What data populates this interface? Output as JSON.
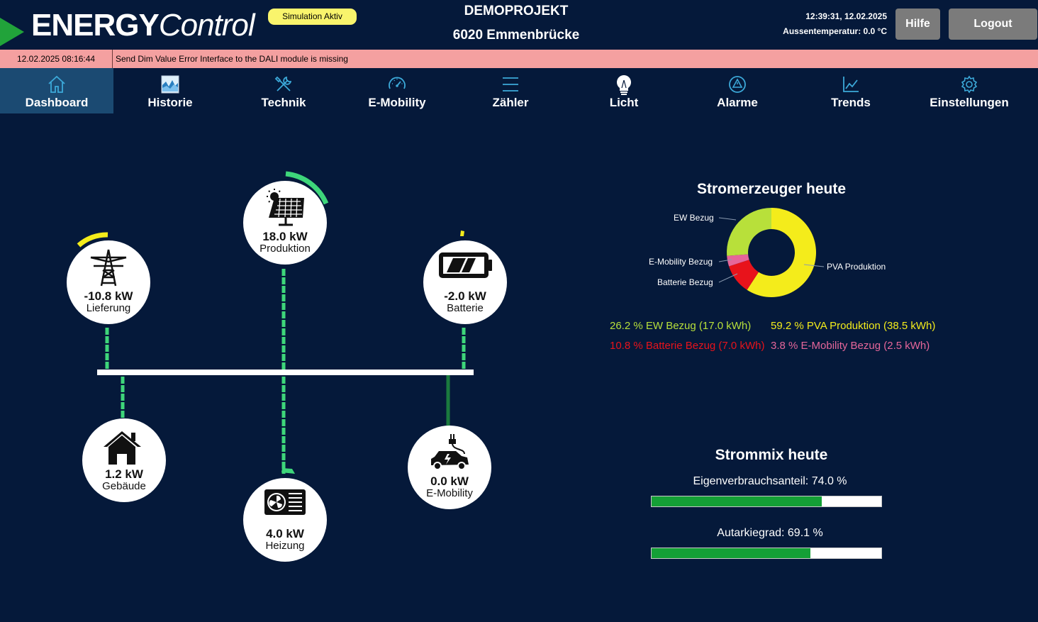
{
  "header": {
    "logo_part1": "ENERGY",
    "logo_part2": "Control",
    "simulation_badge": "Simulation Aktiv",
    "project_name": "DEMOPROJEKT",
    "project_location": "6020 Emmenbrücke",
    "datetime": "12:39:31, 12.02.2025",
    "outside_temp": "Aussentemperatur: 0.0 °C",
    "help_label": "Hilfe",
    "logout_label": "Logout"
  },
  "alarm": {
    "timestamp": "12.02.2025 08:16:44",
    "message": "Send Dim Value Error  Interface to the DALI module is missing"
  },
  "nav": [
    {
      "label": "Dashboard",
      "icon": "home-icon",
      "active": true
    },
    {
      "label": "Historie",
      "icon": "history-chart-icon",
      "active": false
    },
    {
      "label": "Technik",
      "icon": "tools-icon",
      "active": false
    },
    {
      "label": "E-Mobility",
      "icon": "gauge-icon",
      "active": false
    },
    {
      "label": "Zähler",
      "icon": "menu-lines-icon",
      "active": false
    },
    {
      "label": "Licht",
      "icon": "lightbulb-icon",
      "active": false
    },
    {
      "label": "Alarme",
      "icon": "alarm-triangle-icon",
      "active": false
    },
    {
      "label": "Trends",
      "icon": "trend-chart-icon",
      "active": false
    },
    {
      "label": "Einstellungen",
      "icon": "settings-gear-icon",
      "active": false
    }
  ],
  "flow": {
    "grid": {
      "value": "-10.8 kW",
      "label": "Lieferung",
      "icon": "power-tower-icon"
    },
    "solar": {
      "value": "18.0 kW",
      "label": "Produktion",
      "icon": "solar-panel-icon"
    },
    "battery": {
      "value": "-2.0 kW",
      "label": "Batterie",
      "icon": "battery-icon"
    },
    "building": {
      "value": "1.2 kW",
      "label": "Gebäude",
      "icon": "house-icon"
    },
    "heating": {
      "value": "4.0 kW",
      "label": "Heizung",
      "icon": "heat-pump-icon"
    },
    "emobility": {
      "value": "0.0 kW",
      "label": "E-Mobility",
      "icon": "ev-car-icon"
    }
  },
  "colors": {
    "background": "#05193a",
    "nav_active": "#1b4a72",
    "alarm_bar": "#f4a0a0",
    "flow_line": "#3ed67a",
    "bar_fill": "#14a036"
  },
  "chart_data": {
    "type": "pie",
    "title": "Stromerzeuger heute",
    "slices": [
      {
        "name": "PVA Produktion",
        "percent": 59.2,
        "kwh": 38.5,
        "color": "#f4ec1b"
      },
      {
        "name": "Batterie Bezug",
        "percent": 10.8,
        "kwh": 7.0,
        "color": "#e8131b"
      },
      {
        "name": "E-Mobility Bezug",
        "percent": 3.8,
        "kwh": 2.5,
        "color": "#e6669a"
      },
      {
        "name": "EW Bezug",
        "percent": 26.2,
        "kwh": 17.0,
        "color": "#b8e03a"
      }
    ],
    "legend": [
      {
        "text": "26.2 % EW Bezug (17.0 kWh)",
        "color": "#b8e03a"
      },
      {
        "text": "59.2 % PVA Produktion (38.5 kWh)",
        "color": "#f4ec1b"
      },
      {
        "text": "10.8 % Batterie Bezug (7.0 kWh)",
        "color": "#e8131b"
      },
      {
        "text": "3.8 % E-Mobility Bezug (2.5 kWh)",
        "color": "#e6669a"
      }
    ]
  },
  "strommix": {
    "title": "Strommix heute",
    "eigen_label": "Eigenverbrauchsanteil: 74.0 %",
    "eigen_value": 74.0,
    "autarkie_label": "Autarkiegrad: 69.1 %",
    "autarkie_value": 69.1
  }
}
